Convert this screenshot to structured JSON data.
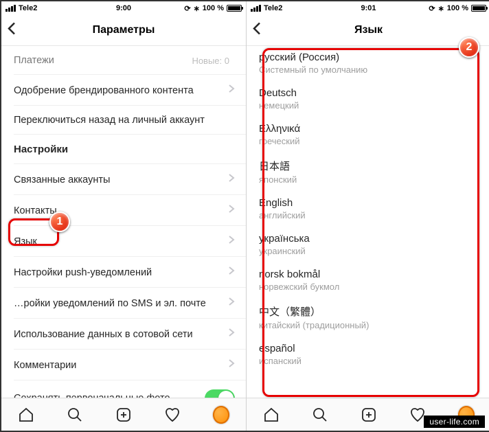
{
  "left": {
    "status": {
      "carrier": "Tele2",
      "time": "9:00",
      "battery": "100 %"
    },
    "nav": {
      "title": "Параметры"
    },
    "rows": [
      {
        "label": "Платежи",
        "meta": "Новые: 0",
        "kind": "partial-top"
      },
      {
        "label": "Одобрение брендированного контента",
        "chev": true
      },
      {
        "label": "Переключиться назад на личный аккаунт"
      },
      {
        "label": "Настройки",
        "kind": "section"
      },
      {
        "label": "Связанные аккаунты",
        "chev": true
      },
      {
        "label": "Контакты",
        "chev": true
      },
      {
        "label": "Язык",
        "chev": true
      },
      {
        "label": "Настройки push-уведомлений",
        "chev": true
      },
      {
        "label": "…ройки уведомлений по SMS и эл. почте",
        "chev": true
      },
      {
        "label": "Использование данных в сотовой сети",
        "chev": true
      },
      {
        "label": "Комментарии",
        "chev": true
      },
      {
        "label": "Сохранять первоначальные фото",
        "toggle": true
      }
    ]
  },
  "right": {
    "status": {
      "carrier": "Tele2",
      "time": "9:01",
      "battery": "100 %"
    },
    "nav": {
      "title": "Язык"
    },
    "languages": [
      {
        "name": "русский (Россия)",
        "sub": "Системный по умолчанию"
      },
      {
        "name": "Deutsch",
        "sub": "немецкий"
      },
      {
        "name": "Ελληνικά",
        "sub": "греческий"
      },
      {
        "name": "日本語",
        "sub": "японский"
      },
      {
        "name": "English",
        "sub": "английский"
      },
      {
        "name": "українська",
        "sub": "украинский"
      },
      {
        "name": "norsk bokmål",
        "sub": "норвежский букмол"
      },
      {
        "name": "中文（繁體）",
        "sub": "китайский (традиционный)"
      },
      {
        "name": "español",
        "sub": "испанский"
      }
    ]
  },
  "annotations": {
    "badge1": "1",
    "badge2": "2"
  },
  "watermark": "user-life.com"
}
